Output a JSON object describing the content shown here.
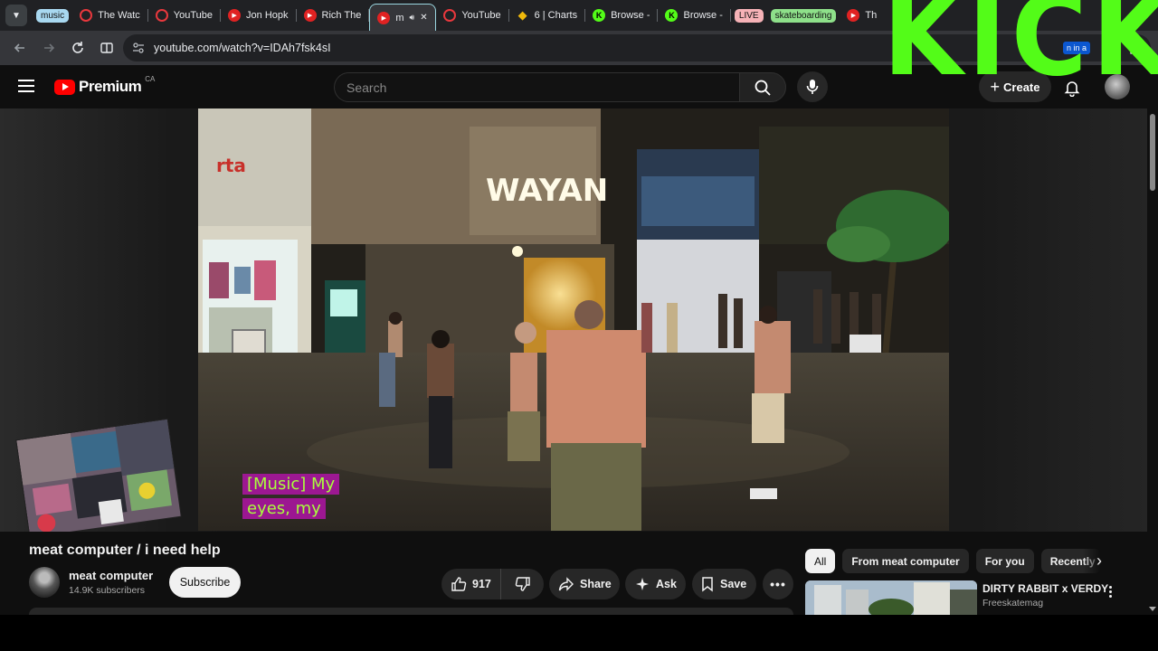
{
  "browser": {
    "tabs": [
      {
        "type": "group",
        "label": "music",
        "color": "#a8d8f0"
      },
      {
        "label": "The Watc",
        "icon": "youtube-ring-icon"
      },
      {
        "label": "YouTube",
        "icon": "youtube-ring-icon"
      },
      {
        "label": "Jon Hopk",
        "icon": "youtube-icon"
      },
      {
        "label": "Rich The",
        "icon": "youtube-icon"
      },
      {
        "label": "m",
        "icon": "youtube-icon",
        "active": true,
        "audio": true
      },
      {
        "label": "YouTube",
        "icon": "youtube-ring-icon"
      },
      {
        "label": "6 | Charts",
        "icon": "binance-icon"
      },
      {
        "label": "Browse -",
        "icon": "kick-icon"
      },
      {
        "label": "Browse -",
        "icon": "kick-icon"
      },
      {
        "type": "group",
        "label": "LIVE",
        "color": "#f6b2b7"
      },
      {
        "type": "group",
        "label": "skateboarding",
        "color": "#8ee08a"
      },
      {
        "label": "Th",
        "icon": "youtube-icon"
      }
    ],
    "url": "youtube.com/watch?v=IDAh7fsk4sI",
    "profile_badge": "n in a"
  },
  "overlay": {
    "kick_text": "KICK",
    "color": "#53fc18"
  },
  "youtube": {
    "logo_text": "Premium",
    "country_code": "CA",
    "search_placeholder": "Search",
    "create_label": "Create"
  },
  "video": {
    "caption_lines": [
      "[Music] My",
      "eyes, my"
    ],
    "storefront_sign": "WAYAN"
  },
  "watch": {
    "title": "meat computer / i need help",
    "channel_name": "meat computer",
    "subscribers": "14.9K subscribers",
    "subscribe_label": "Subscribe",
    "like_count": "917",
    "share_label": "Share",
    "ask_label": "Ask",
    "save_label": "Save"
  },
  "chips": [
    "All",
    "From meat computer",
    "For you",
    "Recently"
  ],
  "recommendation": {
    "title": "DIRTY RABBIT x VERDY",
    "channel": "Freeskatemag"
  }
}
